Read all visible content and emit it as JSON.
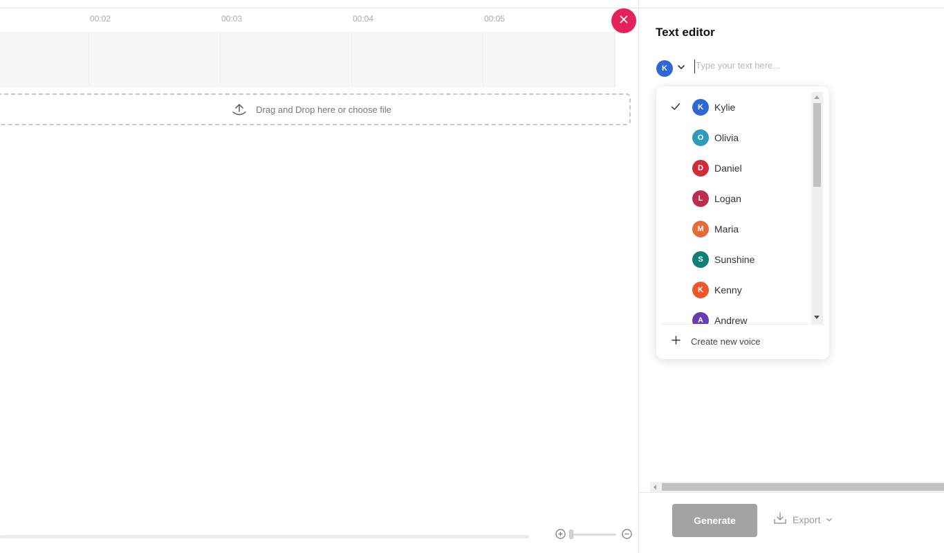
{
  "timeline": {
    "ticks": [
      "00:02",
      "00:03",
      "00:04",
      "00:05"
    ]
  },
  "dropzone": {
    "label": "Drag and Drop here or choose file"
  },
  "panel": {
    "title": "Text editor",
    "selected_voice_initial": "K",
    "text_placeholder": "Type your text here..."
  },
  "voices": {
    "items": [
      {
        "name": "Kylie",
        "initial": "K",
        "color": "#2f67d6",
        "selected": true
      },
      {
        "name": "Olivia",
        "initial": "O",
        "color": "#2e9bbd",
        "selected": false
      },
      {
        "name": "Daniel",
        "initial": "D",
        "color": "#d32b3a",
        "selected": false
      },
      {
        "name": "Logan",
        "initial": "L",
        "color": "#bb2f4c",
        "selected": false
      },
      {
        "name": "Maria",
        "initial": "M",
        "color": "#e66a38",
        "selected": false
      },
      {
        "name": "Sunshine",
        "initial": "S",
        "color": "#0f7f7a",
        "selected": false
      },
      {
        "name": "Kenny",
        "initial": "K",
        "color": "#f2542b",
        "selected": false
      },
      {
        "name": "Andrew",
        "initial": "A",
        "color": "#6a3cb0",
        "selected": false
      }
    ],
    "create_label": "Create new voice"
  },
  "actions": {
    "generate_label": "Generate",
    "export_label": "Export"
  },
  "colors": {
    "accent_close": "#e5235a",
    "selected_avatar": "#2f67d6",
    "generate_bg": "#a3a3a3"
  }
}
